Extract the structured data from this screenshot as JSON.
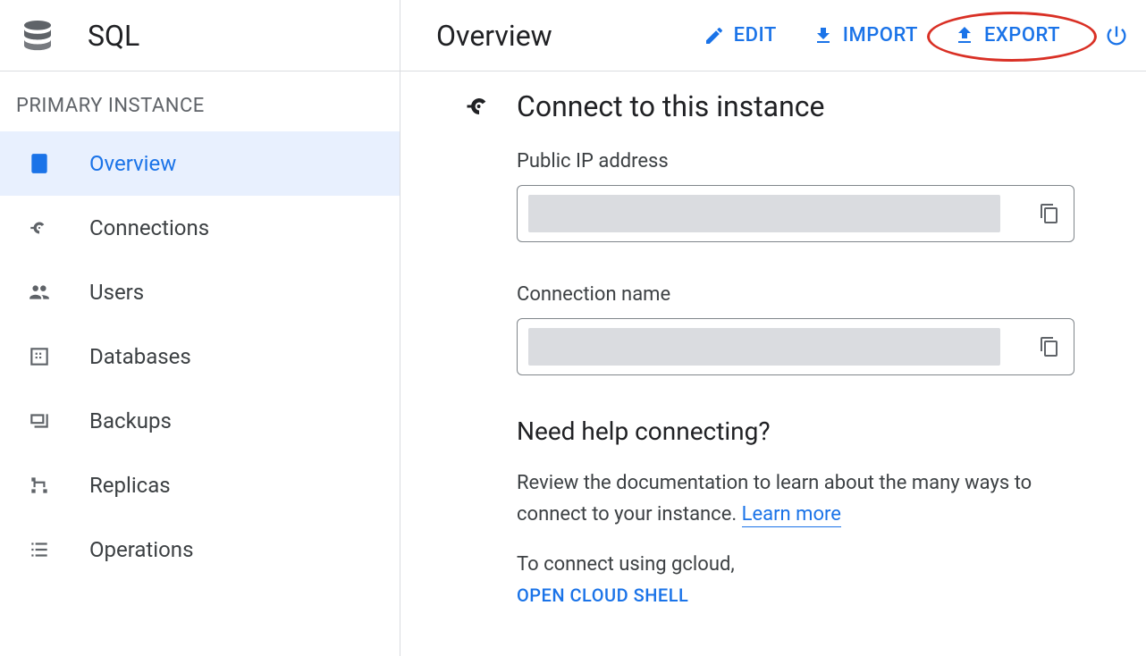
{
  "product": {
    "title": "SQL"
  },
  "sidebar": {
    "section_label": "PRIMARY INSTANCE",
    "items": [
      {
        "label": "Overview"
      },
      {
        "label": "Connections"
      },
      {
        "label": "Users"
      },
      {
        "label": "Databases"
      },
      {
        "label": "Backups"
      },
      {
        "label": "Replicas"
      },
      {
        "label": "Operations"
      }
    ]
  },
  "topbar": {
    "page_title": "Overview",
    "edit": "EDIT",
    "import": "IMPORT",
    "export": "EXPORT"
  },
  "connect_card": {
    "title": "Connect to this instance",
    "public_ip_label": "Public IP address",
    "connection_name_label": "Connection name"
  },
  "help": {
    "title": "Need help connecting?",
    "text_part1": "Review the documentation to learn about the many ways to connect to your instance. ",
    "learn_more": "Learn more",
    "gcloud_text": "To connect using gcloud,",
    "open_cloud_shell": "OPEN CLOUD SHELL"
  }
}
